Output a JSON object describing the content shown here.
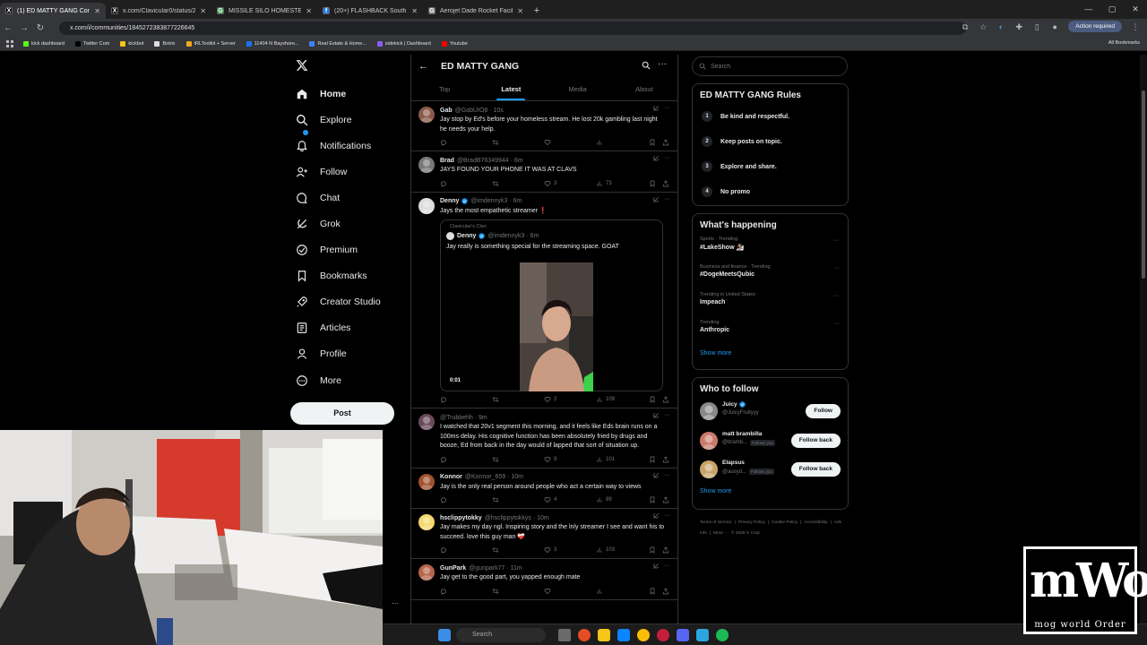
{
  "browser": {
    "tabs": [
      {
        "title": "(1) ED MATTY GANG Community",
        "fav": "X",
        "fav_color": "#000000",
        "active": true
      },
      {
        "title": "x.com/Clavicular0/status/2039",
        "fav": "X",
        "fav_color": "#000000",
        "active": false
      },
      {
        "title": "MISSILE SILO HOMESTEAD - G",
        "fav": "G",
        "fav_color": "#34a853",
        "active": false
      },
      {
        "title": "(20+) FLASHBACK South Florid",
        "fav": "f",
        "fav_color": "#1877f2",
        "active": false
      },
      {
        "title": "Aerojet Dade Rocket Facility | A",
        "fav": "G",
        "fav_color": "#888888",
        "active": false
      }
    ],
    "url": "x.com/i/communities/1845272383877226645",
    "action_required": "Action required",
    "bookmarks": [
      {
        "label": "kick dashboard",
        "color": "#53fc18"
      },
      {
        "label": "Twitter Com",
        "color": "#000000"
      },
      {
        "label": "kickbot",
        "color": "#f5c518"
      },
      {
        "label": "Botrix",
        "color": "#dddddd"
      },
      {
        "label": "IRLToolkit + Server",
        "color": "#f5a623"
      },
      {
        "label": "11404 N Bayshore...",
        "color": "#1a73e8"
      },
      {
        "label": "Real Estate & Home...",
        "color": "#3b82f6"
      },
      {
        "label": "sidekick | Dashboard",
        "color": "#8b5cf6"
      },
      {
        "label": "Youtube",
        "color": "#ff0000"
      }
    ],
    "all_bookmarks": "All Bookmarks"
  },
  "nav": {
    "items": [
      {
        "label": "Home",
        "icon": "home-icon"
      },
      {
        "label": "Explore",
        "icon": "search-icon"
      },
      {
        "label": "Notifications",
        "icon": "bell-icon"
      },
      {
        "label": "Follow",
        "icon": "follow-icon"
      },
      {
        "label": "Chat",
        "icon": "chat-icon"
      },
      {
        "label": "Grok",
        "icon": "grok-icon"
      },
      {
        "label": "Premium",
        "icon": "premium-icon"
      },
      {
        "label": "Bookmarks",
        "icon": "bookmark-icon"
      },
      {
        "label": "Creator Studio",
        "icon": "rocket-icon"
      },
      {
        "label": "Articles",
        "icon": "articles-icon"
      },
      {
        "label": "Profile",
        "icon": "person-icon"
      },
      {
        "label": "More",
        "icon": "more-circle-icon"
      }
    ],
    "post_label": "Post"
  },
  "community": {
    "title": "ED MATTY GANG",
    "tabs": [
      "Top",
      "Latest",
      "Media",
      "About"
    ],
    "active_tab": "Latest"
  },
  "posts": [
    {
      "name": "Gab",
      "handle": "@GabUIO8 · 10s",
      "verified": false,
      "text": "Jay stop by Ed's before your homeless stream. He lost 20k gambling last night he needs your help.",
      "likes": "",
      "views": "",
      "avatar_color": "#8a5a4a"
    },
    {
      "name": "Brad",
      "handle": "@BradB76349944 · 6m",
      "verified": false,
      "text": "JAYS FOUND YOUR PHONE IT WAS AT CLAVS",
      "likes": "3",
      "views": "73",
      "avatar_color": "#777777"
    },
    {
      "name": "Denny",
      "handle": "@imdennyk3 · 6m",
      "verified": true,
      "text": "Jays the most empathetic streamer ❗",
      "likes": "2",
      "views": "109",
      "avatar_color": "#dddddd",
      "quote": {
        "community": "Clavicular's Clan",
        "name": "Denny",
        "handle": "@imdennyk3 · 6m",
        "text": "Jay really is something special for the streaming space. GOAT",
        "video_time": "0:01"
      }
    },
    {
      "name": "",
      "handle": "@Trubbehh · 9m",
      "verified": false,
      "text": "I watched that 20v1 segment this morning, and it feels like Eds brain runs on a 100ms delay. His cognitive function has been absolutely fried by drugs and booze, Ed from back in the day would of lapped that sort of situation up.",
      "likes": "9",
      "views": "101",
      "avatar_color": "#6a4a5a"
    },
    {
      "name": "Konnor",
      "handle": "@Konnor_659 · 10m",
      "verified": false,
      "text": "Jay is the only real person around people who act a certain way to views",
      "likes": "4",
      "views": "99",
      "avatar_color": "#a0522d"
    },
    {
      "name": "hsclippytokky",
      "handle": "@hsclippytokkys · 10m",
      "verified": false,
      "text": "Jay makes my day ngl. Inspiring story and the lnly streamer I see and want his to succeed. love this guy man ❤️‍🩹",
      "likes": "3",
      "views": "103",
      "avatar_color": "#f5d76e"
    },
    {
      "name": "GunPark",
      "handle": "@gunpark77 · 11m",
      "verified": false,
      "text": "Jay get to the good part, you yapped enough mate",
      "likes": "",
      "views": "",
      "avatar_color": "#b5654a"
    }
  ],
  "sidebar": {
    "search_placeholder": "Search",
    "rules_title": "ED MATTY GANG Rules",
    "rules": [
      {
        "num": "1",
        "text": "Be kind and respectful."
      },
      {
        "num": "2",
        "text": "Keep posts on topic."
      },
      {
        "num": "3",
        "text": "Explore and share."
      },
      {
        "num": "4",
        "text": "No promo"
      }
    ],
    "happening_title": "What's happening",
    "trends": [
      {
        "category": "Sports · Trending",
        "name": "#LakeShow 🏂"
      },
      {
        "category": "Business and finance · Trending",
        "name": "#DogeMeetsQubic"
      },
      {
        "category": "Trending in United States",
        "name": "Impeach"
      },
      {
        "category": "Trending",
        "name": "Anthropic"
      }
    ],
    "show_more": "Show more",
    "wtf_title": "Who to follow",
    "who_to_follow": [
      {
        "name": "Juicy",
        "handle": "@JuicyFruityyy",
        "verified": true,
        "follows_you": "",
        "button": "Follow",
        "avatar_color": "#888888"
      },
      {
        "name": "matt brambilla",
        "handle": "@bramb...",
        "verified": false,
        "follows_you": "Follows you",
        "button": "Follow back",
        "avatar_color": "#c97a6a"
      },
      {
        "name": "Elapsus",
        "handle": "@ausyd...",
        "verified": false,
        "follows_you": "Follows you",
        "button": "Follow back",
        "avatar_color": "#c9a46a"
      }
    ],
    "footer": [
      "Terms of Service",
      "|",
      "Privacy Policy",
      "|",
      "Cookie Policy",
      "|",
      "Accessibility",
      "|",
      "Ads info",
      "|",
      "More ···",
      "© 2026 X Corp."
    ]
  },
  "taskbar": {
    "search_label": "Search"
  },
  "overlay": {
    "logo_big": "mWo",
    "logo_small": "mog world Order"
  }
}
